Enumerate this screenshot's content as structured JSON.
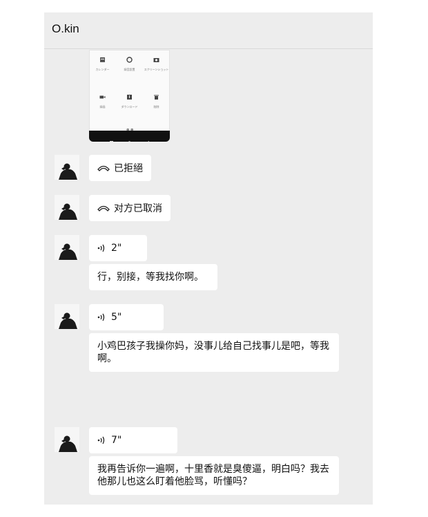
{
  "chat": {
    "title": "O.kin"
  },
  "screenshot_menu": {
    "row1": [
      "カレンダー",
      "録音設置",
      "スクリーンショット"
    ],
    "row2": [
      "録画",
      "ダウンロード",
      "削除"
    ]
  },
  "messages": {
    "call_declined": "已拒絕",
    "call_cancelled": "对方已取消",
    "voice1_duration": "2\"",
    "text1": "行，别接，等我找你啊。",
    "voice2_duration": "5\"",
    "text2": "小鸡巴孩子我操你妈，没事儿给自己找事儿是吧，等我啊。",
    "voice3_duration": "7\"",
    "text3": "我再告诉你一遍啊，十里香就是臭傻逼，明白吗？我去他那儿也这么盯着他脸骂，听懂吗？"
  },
  "icons": {
    "call": "phone-hangup-icon",
    "voice": "voice-wave-icon"
  },
  "colors": {
    "panel_bg": "#ededed",
    "bubble_bg": "#ffffff"
  }
}
